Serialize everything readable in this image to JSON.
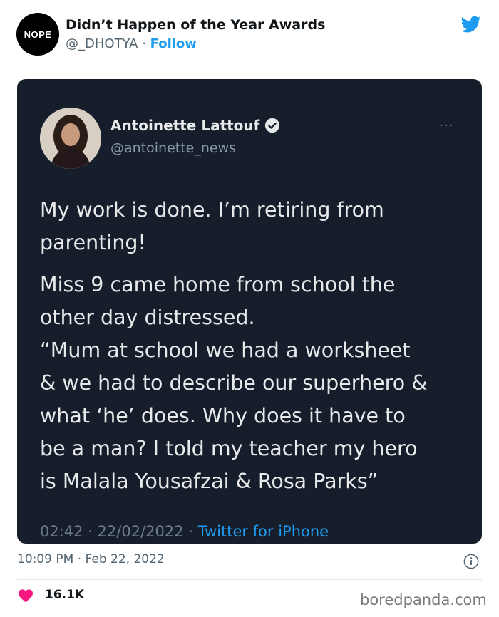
{
  "account": {
    "avatar_text": "NOPE",
    "name": "Didn’t Happen of the Year Awards",
    "handle": "@_DHOTYA",
    "separator": " · ",
    "follow_label": "Follow"
  },
  "embedded_tweet": {
    "author_name": "Antoinette Lattouf",
    "author_handle": "@antoinette_news",
    "more_label": "···",
    "paragraph1": [
      "My work is done. I’m retiring from",
      "parenting!"
    ],
    "paragraph2": [
      "Miss 9 came home from school the",
      "other day distressed.",
      "“Mum at school we had a worksheet",
      "& we had to describe our superhero &",
      "what ‘he’ does. Why does it have to",
      "be a man? I told my teacher my hero",
      "is Malala Yousafzai & Rosa Parks”"
    ],
    "meta_time": "02:42 · 22/02/2022 · ",
    "meta_source": "Twitter for iPhone"
  },
  "tweet": {
    "timestamp": "10:09 PM · Feb 22, 2022",
    "likes": "16.1K"
  },
  "watermark": "boredpanda.com",
  "colors": {
    "brand_blue": "#1d9bf0",
    "embed_bg": "#161e2b",
    "heart": "#f91880"
  }
}
